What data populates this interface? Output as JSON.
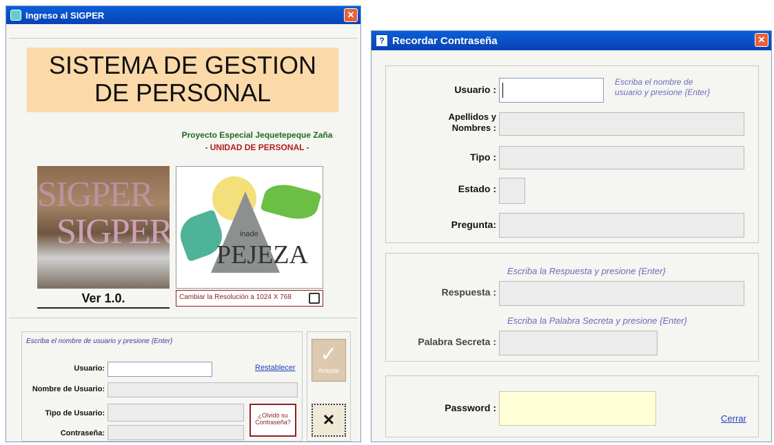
{
  "login": {
    "title": "Ingreso al SIGPER",
    "banner_line1": "SISTEMA DE GESTION",
    "banner_line2": "DE PERSONAL",
    "project_line1": "Proyecto Especial Jequetepeque Zaña",
    "project_line2": "- UNIDAD DE PERSONAL -",
    "logo_text1": "SIGPER",
    "logo_text2": "SIGPER",
    "inade": "inade",
    "pejeza": "PEJEZA",
    "version": "Ver 1.0.",
    "resolution_hint": "Cambiar la Resolución a 1024 X 768",
    "form_hint": "Escriba el nombre de usuario y presione {Enter}",
    "usuario_label": "Usuario:",
    "restablecer": "Restablecer",
    "nombre_label": "Nombre de Usuario:",
    "tipo_label": "Tipo de Usuario:",
    "contrasena_label": "Contraseña:",
    "olvido_line1": "¿Olvidó su",
    "olvido_line2": "Contraseña?",
    "aceptar": "Aceptar",
    "cancel_glyph": "✕"
  },
  "recover": {
    "title": "Recordar Contraseña",
    "usuario_label": "Usuario :",
    "usuario_hint_1": "Escriba el nombre de",
    "usuario_hint_2": "usuario y presione {Enter}",
    "apellidos_label_1": "Apellidos y",
    "apellidos_label_2": "Nombres :",
    "tipo_label": "Tipo :",
    "estado_label": "Estado :",
    "pregunta_label": "Pregunta:",
    "respuesta_hint": "Escriba la Respuesta y presione {Enter}",
    "respuesta_label": "Respuesta :",
    "palabra_hint": "Escriba la Palabra Secreta y presione {Enter}",
    "palabra_label": "Palabra Secreta :",
    "password_label": "Password :",
    "cerrar": "Cerrar"
  },
  "icons": [
    "app-icon",
    "close-icon",
    "help-icon",
    "monitor-icon",
    "checkmark-icon",
    "cancel-icon"
  ]
}
